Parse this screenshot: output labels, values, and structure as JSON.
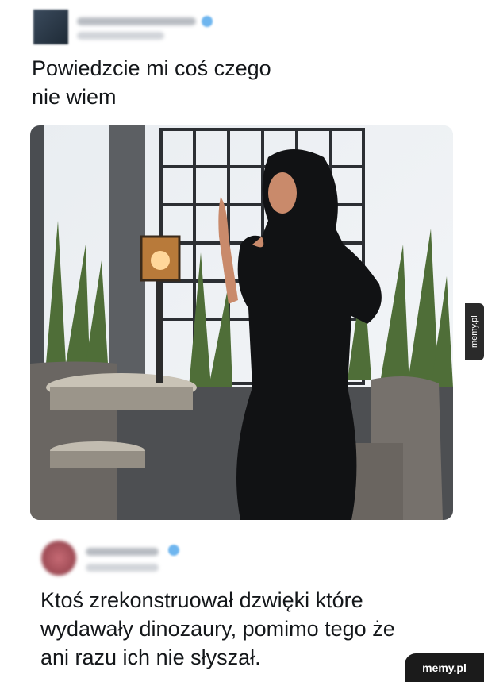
{
  "tweet1": {
    "text_line1": "Powiedzcie mi coś czego",
    "text_line2": "nie wiem"
  },
  "tweet2": {
    "text_line1": "Ktoś zrekonstruował dzwięki które",
    "text_line2": "wydawały dinozaury, pomimo tego że",
    "text_line3": "ani razu ich nie słyszał."
  },
  "watermark": {
    "side": "memy.pl",
    "corner": "memy.pl"
  },
  "colors": {
    "verified": "#6fb6ef",
    "text": "#14171a",
    "badge_bg": "#1b1b1b"
  }
}
